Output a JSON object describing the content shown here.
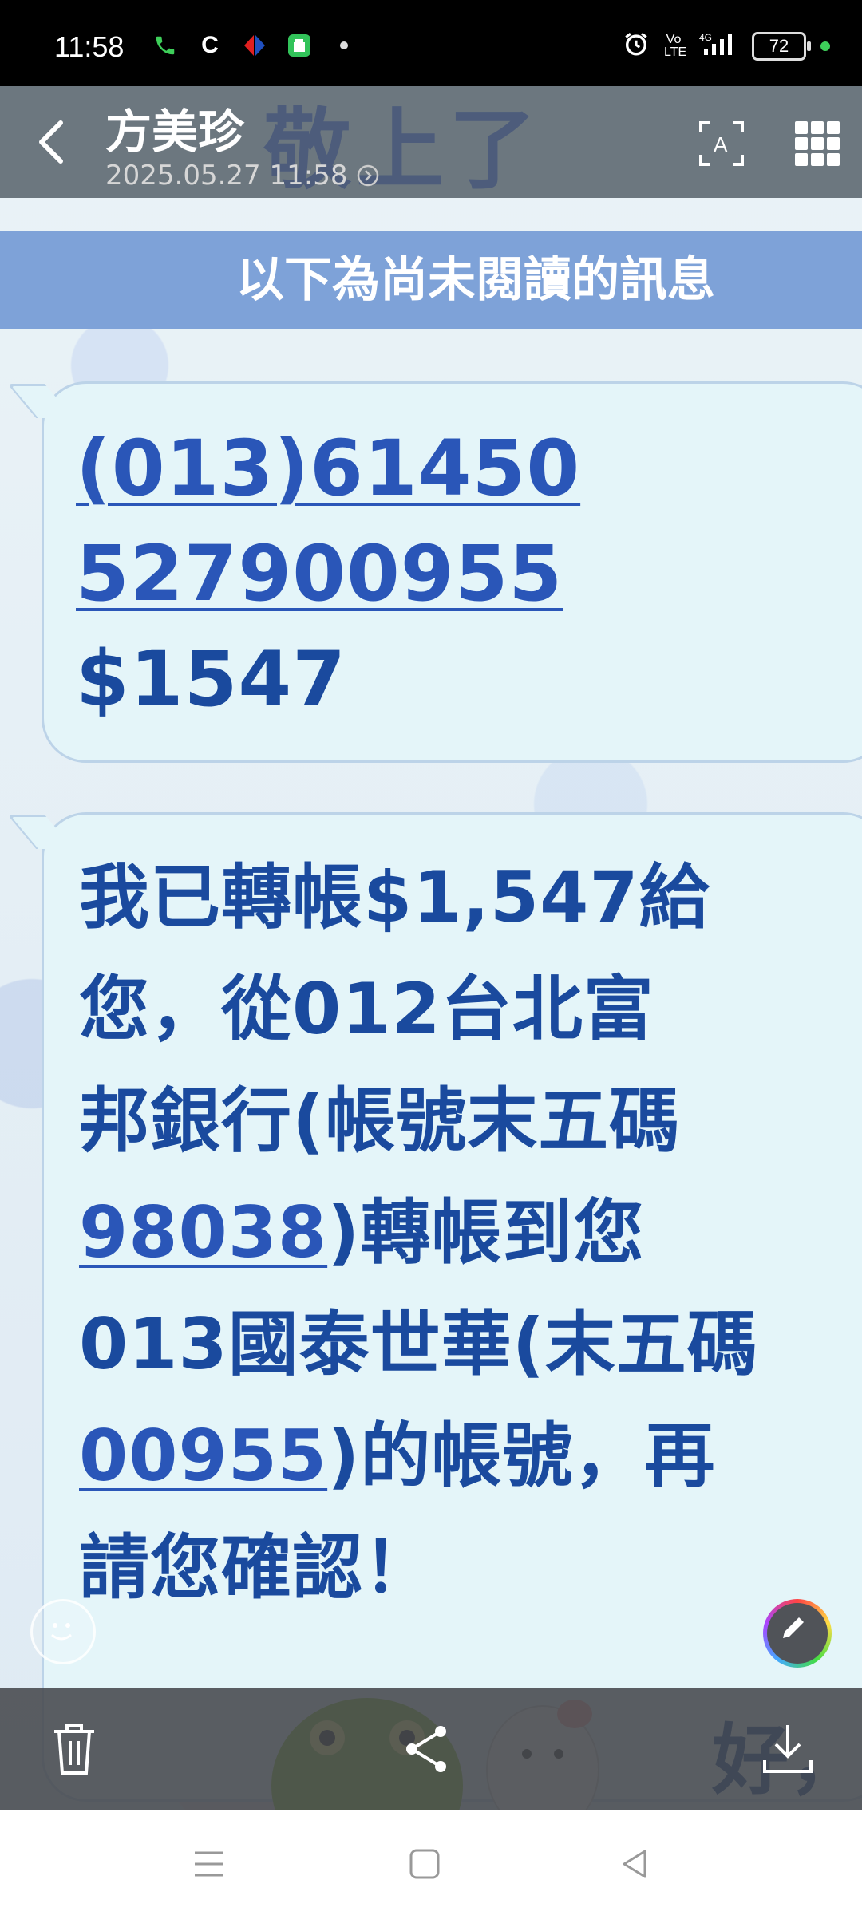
{
  "status_bar": {
    "time": "11:58",
    "battery": "72",
    "left_icons": [
      "phone-icon",
      "c-app-icon",
      "carrefour-icon",
      "store-icon",
      "dot-icon"
    ],
    "right_icons": [
      "alarm-icon",
      "volte-icon",
      "4g-signal-icon",
      "battery-icon"
    ]
  },
  "header": {
    "contact_name": "方美珍",
    "timestamp": "2025.05.27 11:58",
    "ghost_text": "敬上了"
  },
  "banner": {
    "text": "以下為尚未閱讀的訊息"
  },
  "message1": {
    "line1": "(013)61450",
    "line2": "527900955",
    "line3": "$1547"
  },
  "message2": {
    "line1": "我已轉帳$1,547給",
    "line2": "您，從012台北富",
    "line3": "邦銀行(帳號末五碼",
    "line4_link": "98038",
    "line4_rest": ")轉帳到您",
    "line5": "013國泰世華(末五碼",
    "line6_link": "00955",
    "line6_rest": ")的帳號，再",
    "line7": "請您確認！"
  },
  "partial_next": "好，",
  "colors": {
    "banner": "#7ea2d8",
    "bubble_bg": "#e4f5f9",
    "bubble_text": "#1a4a9e",
    "link": "#2a56b8"
  }
}
